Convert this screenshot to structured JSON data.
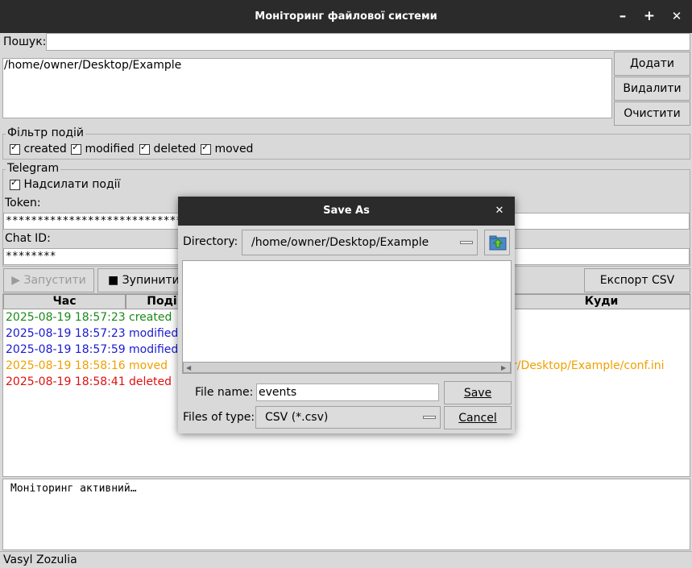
{
  "window": {
    "title": "Моніторинг файлової системи",
    "minimize": "–",
    "maximize": "+",
    "close": "✕"
  },
  "search": {
    "label": "Пошук:",
    "value": ""
  },
  "paths": {
    "items": [
      "/home/owner/Desktop/Example"
    ]
  },
  "path_buttons": {
    "add": "Додати",
    "remove": "Видалити",
    "clear": "Очистити"
  },
  "filter": {
    "title": "Фільтр подій",
    "options": [
      "created",
      "modified",
      "deleted",
      "moved"
    ]
  },
  "telegram": {
    "title": "Telegram",
    "send_label": "Надсилати події",
    "token_label": "Token:",
    "token_value": "*********************************************************************",
    "chat_label": "Chat ID:",
    "chat_value": "********"
  },
  "controls": {
    "start": "▶ Запустити",
    "stop": "■ Зупинити",
    "export": "Експорт CSV"
  },
  "table": {
    "headers": {
      "time": "Час",
      "event": "Поді",
      "to": "Куди"
    },
    "rows": [
      {
        "time": "2025-08-19 18:57:23",
        "event": "created",
        "to": "",
        "color": "#1a8a1a"
      },
      {
        "time": "2025-08-19 18:57:23",
        "event": "modified",
        "to": "",
        "color": "#1a1ad0"
      },
      {
        "time": "2025-08-19 18:57:59",
        "event": "modified",
        "to": "",
        "color": "#1a1ad0"
      },
      {
        "time": "2025-08-19 18:58:16",
        "event": "moved",
        "to": "r/Desktop/Example/conf.ini",
        "color": "#f0a000"
      },
      {
        "time": "2025-08-19 18:58:41",
        "event": "deleted",
        "to": "",
        "color": "#e01010"
      }
    ]
  },
  "log": {
    "text": "Моніторинг активний…"
  },
  "status": {
    "author": "Vasyl Zozulia"
  },
  "dialog": {
    "title": "Save As",
    "close": "✕",
    "directory_label": "Directory:",
    "directory_value": "/home/owner/Desktop/Example",
    "filename_label": "File name:",
    "filename_value": "events",
    "filetype_label": "Files of type:",
    "filetype_value": "CSV (*.csv)",
    "save": "Save",
    "cancel": "Cancel"
  }
}
